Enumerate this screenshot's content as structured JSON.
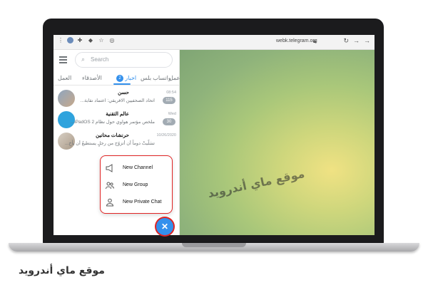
{
  "browser": {
    "url": "webk.telegram.org",
    "icons": [
      "menu-dots-icon",
      "avatar-icon",
      "puzzle-icon",
      "extension-icon",
      "star-icon",
      "telegram-icon",
      "lock-icon",
      "refresh-icon",
      "reload-icon",
      "back-icon"
    ]
  },
  "sidebar": {
    "search_placeholder": "Search",
    "tabs": [
      {
        "label": "العمل"
      },
      {
        "label": "الأصدقاء"
      },
      {
        "label": "اخبار",
        "badge": "2"
      },
      {
        "label": "واتساب بلس"
      },
      {
        "label": "عمل"
      }
    ],
    "chats": [
      {
        "name": "حسن",
        "time": "08:54",
        "message": "اتحاد الصحفيين الافريقي: اعتماد نقابة...",
        "badge": "115"
      },
      {
        "name": "عالم التقنية",
        "time": "Wed",
        "message": "ملخص مؤتمر هواوي حول نظام iPadOS 2...",
        "badge": "30"
      },
      {
        "name": "حرنشات محانين",
        "time": "10/26/2020",
        "message": "تسَلّيتْ دوماً أن أتزوّج من رجلٍ يستطيعُ أن يأخ...",
        "badge": ""
      }
    ]
  },
  "popup": {
    "items": [
      {
        "label": "New Channel",
        "icon": "megaphone-icon"
      },
      {
        "label": "New Group",
        "icon": "group-icon"
      },
      {
        "label": "New Private Chat",
        "icon": "user-icon"
      }
    ]
  },
  "fab": {
    "icon": "close-icon",
    "symbol": "✕"
  },
  "watermark": {
    "text": "موقع ماي أندرويد"
  },
  "footer": {
    "text": "موقع ماي أندرويد"
  },
  "colors": {
    "accent": "#3390ec",
    "highlight": "#e02424"
  }
}
